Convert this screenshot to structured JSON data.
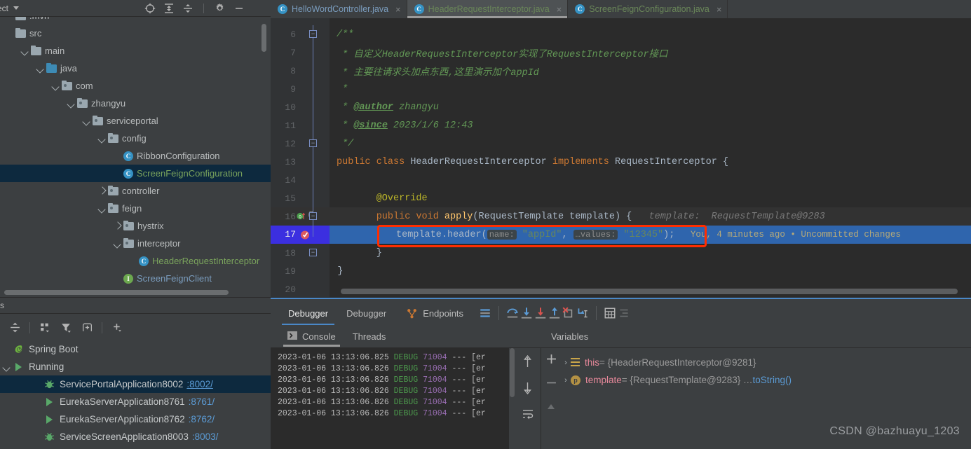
{
  "window": {
    "project_label": "ect",
    "toolbar_icons": [
      "locate-icon",
      "expand-all-icon",
      "collapse-all-icon",
      "gear-icon",
      "minimize-icon"
    ]
  },
  "tabs": [
    {
      "label": "HelloWordController.java",
      "icon": "java-class-icon",
      "color": "blue",
      "active": false,
      "close": "×"
    },
    {
      "label": "HeaderRequestInterceptor.java",
      "icon": "java-class-icon",
      "color": "green",
      "active": true,
      "close": "×"
    },
    {
      "label": "ScreenFeignConfiguration.java",
      "icon": "java-class-icon",
      "color": "green",
      "active": false,
      "close": "×"
    }
  ],
  "project_tree": {
    "items": [
      {
        "label": ".mvn",
        "indent": 0,
        "twist": "",
        "icon": "folder-icon",
        "color": "",
        "selected": false,
        "clipped": true
      },
      {
        "label": "src",
        "indent": 0,
        "twist": "",
        "icon": "folder-icon",
        "color": "",
        "selected": false
      },
      {
        "label": "main",
        "indent": 1,
        "twist": "down",
        "icon": "folder-icon",
        "color": "",
        "selected": false
      },
      {
        "label": "java",
        "indent": 2,
        "twist": "down",
        "icon": "folder-blue-icon",
        "color": "",
        "selected": false
      },
      {
        "label": "com",
        "indent": 3,
        "twist": "down",
        "icon": "package-icon",
        "color": "",
        "selected": false
      },
      {
        "label": "zhangyu",
        "indent": 4,
        "twist": "down",
        "icon": "package-icon",
        "color": "",
        "selected": false
      },
      {
        "label": "serviceportal",
        "indent": 5,
        "twist": "down",
        "icon": "package-icon",
        "color": "",
        "selected": false
      },
      {
        "label": "config",
        "indent": 6,
        "twist": "down",
        "icon": "package-icon",
        "color": "",
        "selected": false
      },
      {
        "label": "RibbonConfiguration",
        "indent": 7,
        "twist": "",
        "icon": "class-icon",
        "color": "",
        "selected": false
      },
      {
        "label": "ScreenFeignConfiguration",
        "indent": 7,
        "twist": "",
        "icon": "class-icon",
        "color": "green",
        "selected": true
      },
      {
        "label": "controller",
        "indent": 6,
        "twist": "right",
        "icon": "package-icon",
        "color": "",
        "selected": false
      },
      {
        "label": "feign",
        "indent": 6,
        "twist": "down",
        "icon": "package-icon",
        "color": "",
        "selected": false
      },
      {
        "label": "hystrix",
        "indent": 7,
        "twist": "right",
        "icon": "package-icon",
        "color": "",
        "selected": false
      },
      {
        "label": "interceptor",
        "indent": 7,
        "twist": "down",
        "icon": "package-icon",
        "color": "",
        "selected": false
      },
      {
        "label": "HeaderRequestInterceptor",
        "indent": 8,
        "twist": "",
        "icon": "class-icon",
        "color": "green",
        "selected": false
      },
      {
        "label": "ScreenFeignClient",
        "indent": 7,
        "twist": "",
        "icon": "interface-icon",
        "color": "blue",
        "selected": false
      }
    ]
  },
  "editor": {
    "lines": [
      {
        "num": "6",
        "fold": "open",
        "html_key": "l6"
      },
      {
        "num": "7",
        "fold": "",
        "html_key": "l7"
      },
      {
        "num": "8",
        "fold": "",
        "html_key": "l8"
      },
      {
        "num": "9",
        "fold": "",
        "html_key": "l9"
      },
      {
        "num": "10",
        "fold": "",
        "html_key": "l10"
      },
      {
        "num": "11",
        "fold": "",
        "html_key": "l11"
      },
      {
        "num": "12",
        "fold": "close",
        "html_key": "l12"
      },
      {
        "num": "13",
        "fold": "",
        "html_key": "l13"
      },
      {
        "num": "14",
        "fold": "",
        "html_key": "l14"
      },
      {
        "num": "15",
        "fold": "",
        "html_key": "l15"
      },
      {
        "num": "16",
        "fold": "open",
        "html_key": "l16"
      },
      {
        "num": "17",
        "fold": "",
        "html_key": "l17"
      },
      {
        "num": "18",
        "fold": "close",
        "html_key": "l18"
      },
      {
        "num": "19",
        "fold": "",
        "html_key": "l19"
      },
      {
        "num": "20",
        "fold": "",
        "html_key": "l20"
      }
    ],
    "text": {
      "l6": "/**",
      "l7": " * 自定义HeaderRequestInterceptor实现了RequestInterceptor接口",
      "l8": " * 主要往请求头加点东西,这里演示加个appId",
      "l9": " *",
      "l10_tag": "@author",
      "l10_rest": " zhangyu",
      "l11_tag": "@since",
      "l11_rest": " 2023/1/6 12:43",
      "l12": "*/",
      "l13_kw1": "public class",
      "l13_name": " HeaderRequestInterceptor ",
      "l13_kw2": "implements",
      "l13_iface": " RequestInterceptor {",
      "l15_ann": "@Override",
      "l16_kw": "public void ",
      "l16_meth": "apply",
      "l16_sig": "(RequestTemplate template) {",
      "l16_hint": "template:  RequestTemplate@9283",
      "l17_obj": "template.",
      "l17_meth": "header",
      "l17_open": "(",
      "l17_hint1": "name:",
      "l17_arg1": "\"appId\"",
      "l17_comma": ", ",
      "l17_hint2": "…values:",
      "l17_arg2": "\"12345\"",
      "l17_close": ");",
      "l17_blame": "You, 4 minutes ago • Uncommitted changes",
      "l18": "}",
      "l19": "}"
    },
    "gutter_markers": {
      "line16": "override-marker",
      "line17": "breakpoint-verified-icon"
    },
    "highlight_box": "red-annotation-box"
  },
  "services": {
    "header_label": "s",
    "toolbar_icons": [
      "collapse-icon",
      "group-by-icon",
      "filter-icon",
      "add-tab-icon",
      "add-icon"
    ],
    "tree": [
      {
        "label": "Spring Boot",
        "indent": 0,
        "twist": "",
        "icon": "spring-boot-icon",
        "port": "",
        "selected": false
      },
      {
        "label": "Running",
        "indent": 0,
        "twist": "down",
        "icon": "run-icon",
        "port": "",
        "selected": false
      },
      {
        "label": "ServicePortalApplication8002",
        "indent": 2,
        "twist": "",
        "icon": "debug-icon",
        "port": ":8002/",
        "selected": true,
        "port_underline": true
      },
      {
        "label": "EurekaServerApplication8761",
        "indent": 2,
        "twist": "",
        "icon": "run-icon",
        "port": ":8761/",
        "selected": false
      },
      {
        "label": "EurekaServerApplication8762",
        "indent": 2,
        "twist": "",
        "icon": "run-icon",
        "port": ":8762/",
        "selected": false
      },
      {
        "label": "ServiceScreenApplication8003",
        "indent": 2,
        "twist": "",
        "icon": "debug-icon",
        "port": ":8003/",
        "selected": false
      }
    ]
  },
  "debugger": {
    "tabs": [
      {
        "label": "Debugger",
        "active": true
      },
      {
        "label": "Debugger",
        "active": false
      },
      {
        "label": "Endpoints",
        "active": false,
        "icon": "endpoints-icon"
      }
    ],
    "toolbar_icons": [
      "layout-settings-icon",
      "step-over-icon",
      "step-into-icon",
      "force-step-into-icon",
      "step-out-icon",
      "drop-frame-icon",
      "run-to-cursor-icon",
      "evaluate-expression-icon",
      "watches-icon"
    ],
    "console_tabs": [
      {
        "label": "Console",
        "active": true,
        "icon": "console-icon"
      },
      {
        "label": "Threads",
        "active": false
      }
    ],
    "console_lines": [
      {
        "ts": "2023-01-06 13:13:06.825",
        "level": "DEBUG",
        "pid": "71004",
        "rest": "--- [er"
      },
      {
        "ts": "2023-01-06 13:13:06.826",
        "level": "DEBUG",
        "pid": "71004",
        "rest": "--- [er"
      },
      {
        "ts": "2023-01-06 13:13:06.826",
        "level": "DEBUG",
        "pid": "71004",
        "rest": "--- [er"
      },
      {
        "ts": "2023-01-06 13:13:06.826",
        "level": "DEBUG",
        "pid": "71004",
        "rest": "--- [er"
      },
      {
        "ts": "2023-01-06 13:13:06.826",
        "level": "DEBUG",
        "pid": "71004",
        "rest": "--- [er"
      },
      {
        "ts": "2023-01-06 13:13:06.826",
        "level": "DEBUG",
        "pid": "71004",
        "rest": "--- [er"
      }
    ],
    "console_side_icons": [
      "up-arrow-icon",
      "down-arrow-icon",
      "soft-wrap-icon"
    ],
    "stepper_icons": [
      "plus-icon",
      "minus-icon",
      "up-triangle-icon"
    ],
    "variables": {
      "title": "Variables",
      "rows": [
        {
          "icon": "field-icon",
          "name": "this",
          "value": "= {HeaderRequestInterceptor@9281}",
          "link": ""
        },
        {
          "icon": "parameter-icon",
          "name": "template",
          "value": "= {RequestTemplate@9283} … ",
          "link": "toString()"
        }
      ]
    }
  },
  "watermark": "CSDN @bazhuayu_1203",
  "colors": {
    "accent_blue": "#4a88c7",
    "selection": "#0d293e",
    "line_highlight": "#2f65ad",
    "red_box": "#ff2d00",
    "green_string": "#6a8759",
    "orange_keyword": "#cc7832"
  }
}
